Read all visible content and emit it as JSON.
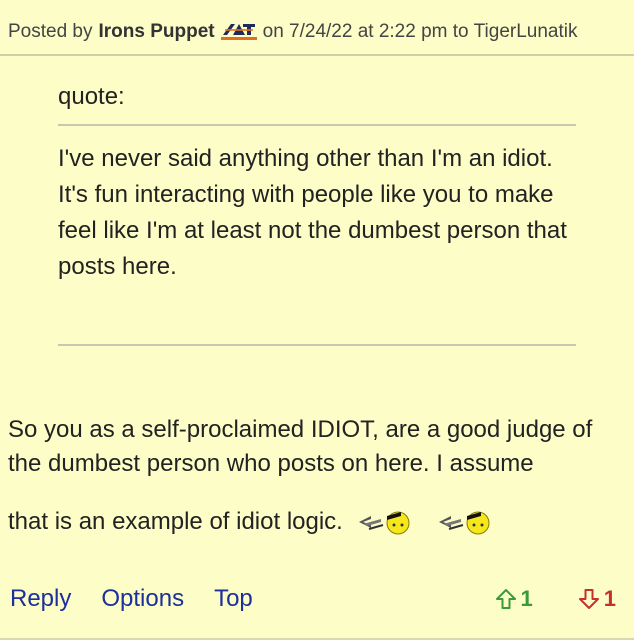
{
  "post": {
    "posted_by_label": "Posted by",
    "author": "Irons Puppet",
    "team_logo_icon": "auburn-tigers-logo-icon",
    "date_text": "on 7/24/22 at 2:22 pm to",
    "reply_to": "TigerLunatik"
  },
  "quote": {
    "label": "quote:",
    "text": "I've never said anything other than I'm an idiot. It's fun interacting with people like you to make feel like I'm at least not the dumbest person that posts here."
  },
  "body": {
    "text_part1": "So you as a self-proclaimed IDIOT, are a good judge of the dumbest person who posts on here. I assume",
    "text_part2": "that is an example of idiot logic.",
    "smileys": [
      "sleeping-smiley-icon",
      "sleeping-smiley-icon"
    ]
  },
  "actions": {
    "reply": "Reply",
    "options": "Options",
    "top": "Top"
  },
  "votes": {
    "up_count": "1",
    "down_count": "1",
    "up_color": "#3a9a3a",
    "down_color": "#c43030"
  },
  "colors": {
    "background": "#fdfdc8",
    "link": "#1c2f9a"
  }
}
